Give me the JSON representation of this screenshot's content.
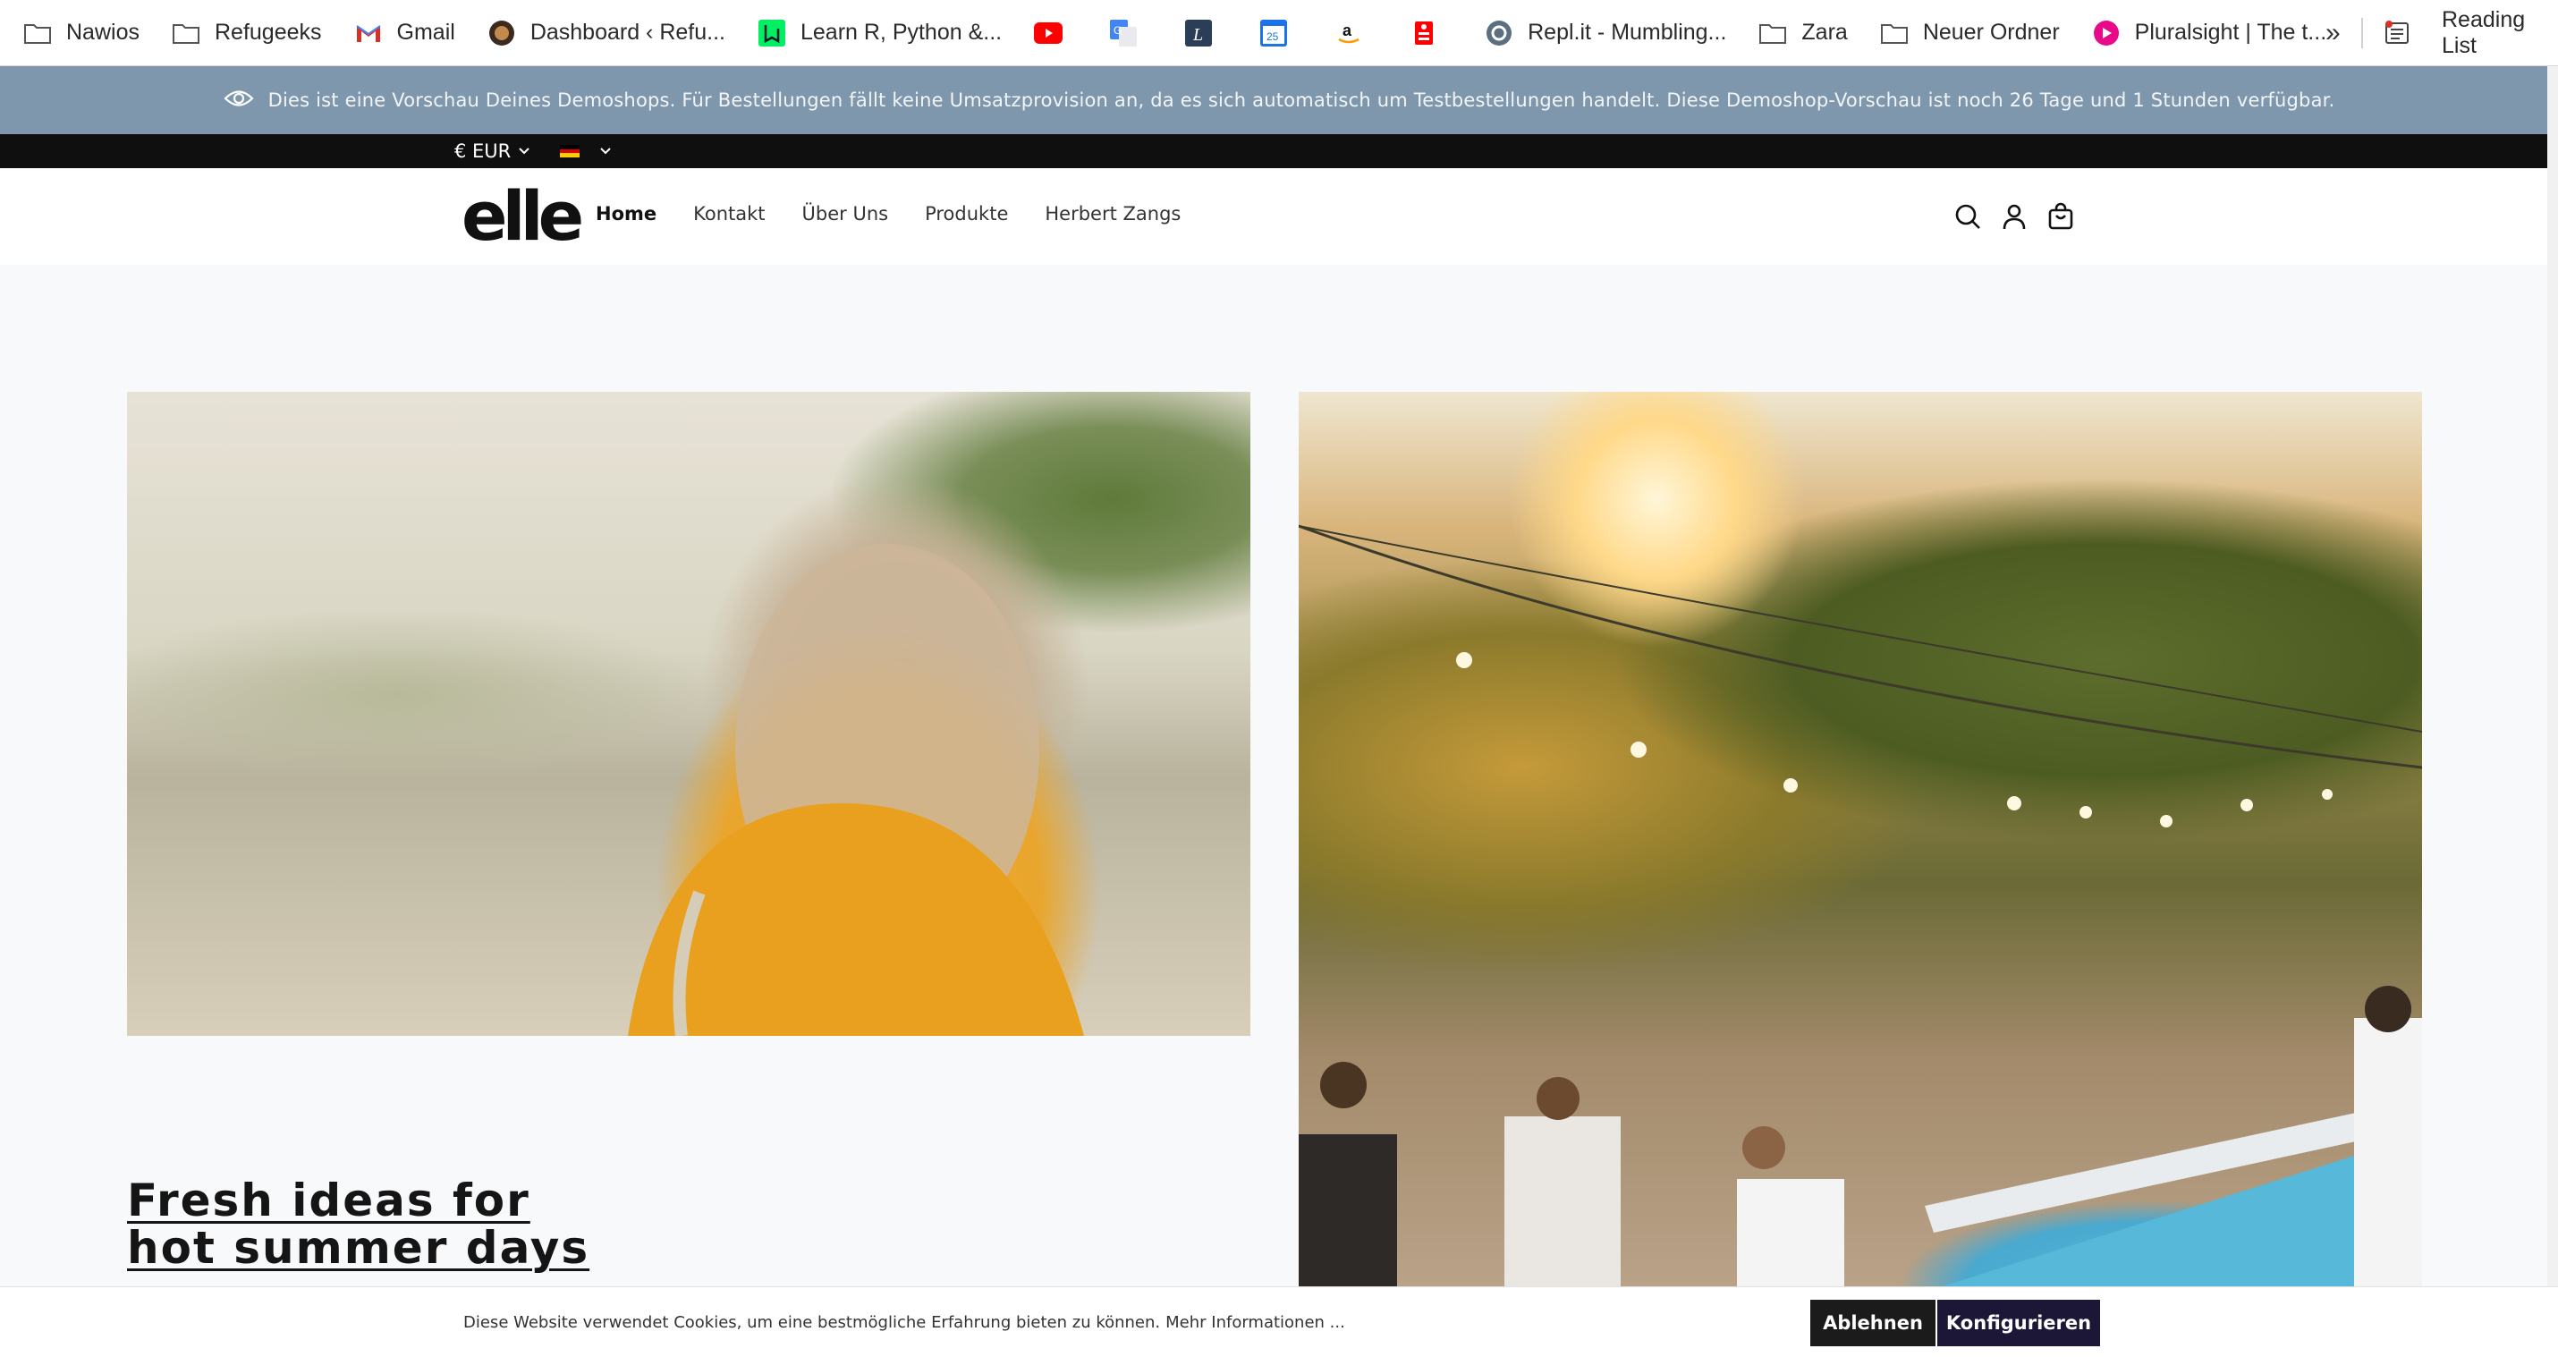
{
  "bookmarks": [
    {
      "label": "Nawios",
      "icon": "folder-icon"
    },
    {
      "label": "Refugeeks",
      "icon": "folder-icon"
    },
    {
      "label": "Gmail",
      "icon": "gmail-icon"
    },
    {
      "label": "Dashboard ‹ Refu...",
      "icon": "wordpress-icon"
    },
    {
      "label": "Learn R, Python &...",
      "icon": "datacamp-icon"
    },
    {
      "label": "",
      "icon": "youtube-icon"
    },
    {
      "label": "",
      "icon": "google-translate-icon"
    },
    {
      "label": "",
      "icon": "linguee-icon"
    },
    {
      "label": "",
      "icon": "calendar-icon"
    },
    {
      "label": "",
      "icon": "amazon-icon"
    },
    {
      "label": "",
      "icon": "sparkasse-icon"
    },
    {
      "label": "Repl.it - Mumbling...",
      "icon": "replit-icon"
    },
    {
      "label": "Zara",
      "icon": "folder-icon"
    },
    {
      "label": "Neuer Ordner",
      "icon": "folder-icon"
    },
    {
      "label": "Pluralsight | The t...",
      "icon": "pluralsight-icon"
    }
  ],
  "bookmarks_more": "»",
  "reading_list": "Reading List",
  "preview_banner": "Dies ist eine Vorschau Deines Demoshops. Für Bestellungen fällt keine Umsatzprovision an, da es sich automatisch um Testbestellungen handelt. Diese Demoshop-Vorschau ist noch 26 Tage und 1 Stunden verfügbar.",
  "topbar": {
    "currency": "€ EUR",
    "language_flag": "germany-flag-icon"
  },
  "header": {
    "logo": "elle",
    "nav": [
      "Home",
      "Kontakt",
      "Über Uns",
      "Produkte",
      "Herbert Zangs"
    ],
    "active_nav": "Home"
  },
  "hero": {
    "headline_line1": "Fresh ideas for",
    "headline_line2": "hot summer days"
  },
  "cookie": {
    "text": "Diese Website verwendet Cookies, um eine bestmögliche Erfahrung bieten zu können.",
    "more_link": "Mehr Informationen ...",
    "decline": "Ablehnen",
    "configure": "Konfigurieren"
  },
  "colors": {
    "preview_banner_bg": "#7f97ad",
    "topbar_bg": "#0f0f10",
    "decline_bg": "#1b1b1b",
    "configure_bg": "#1c1637"
  }
}
